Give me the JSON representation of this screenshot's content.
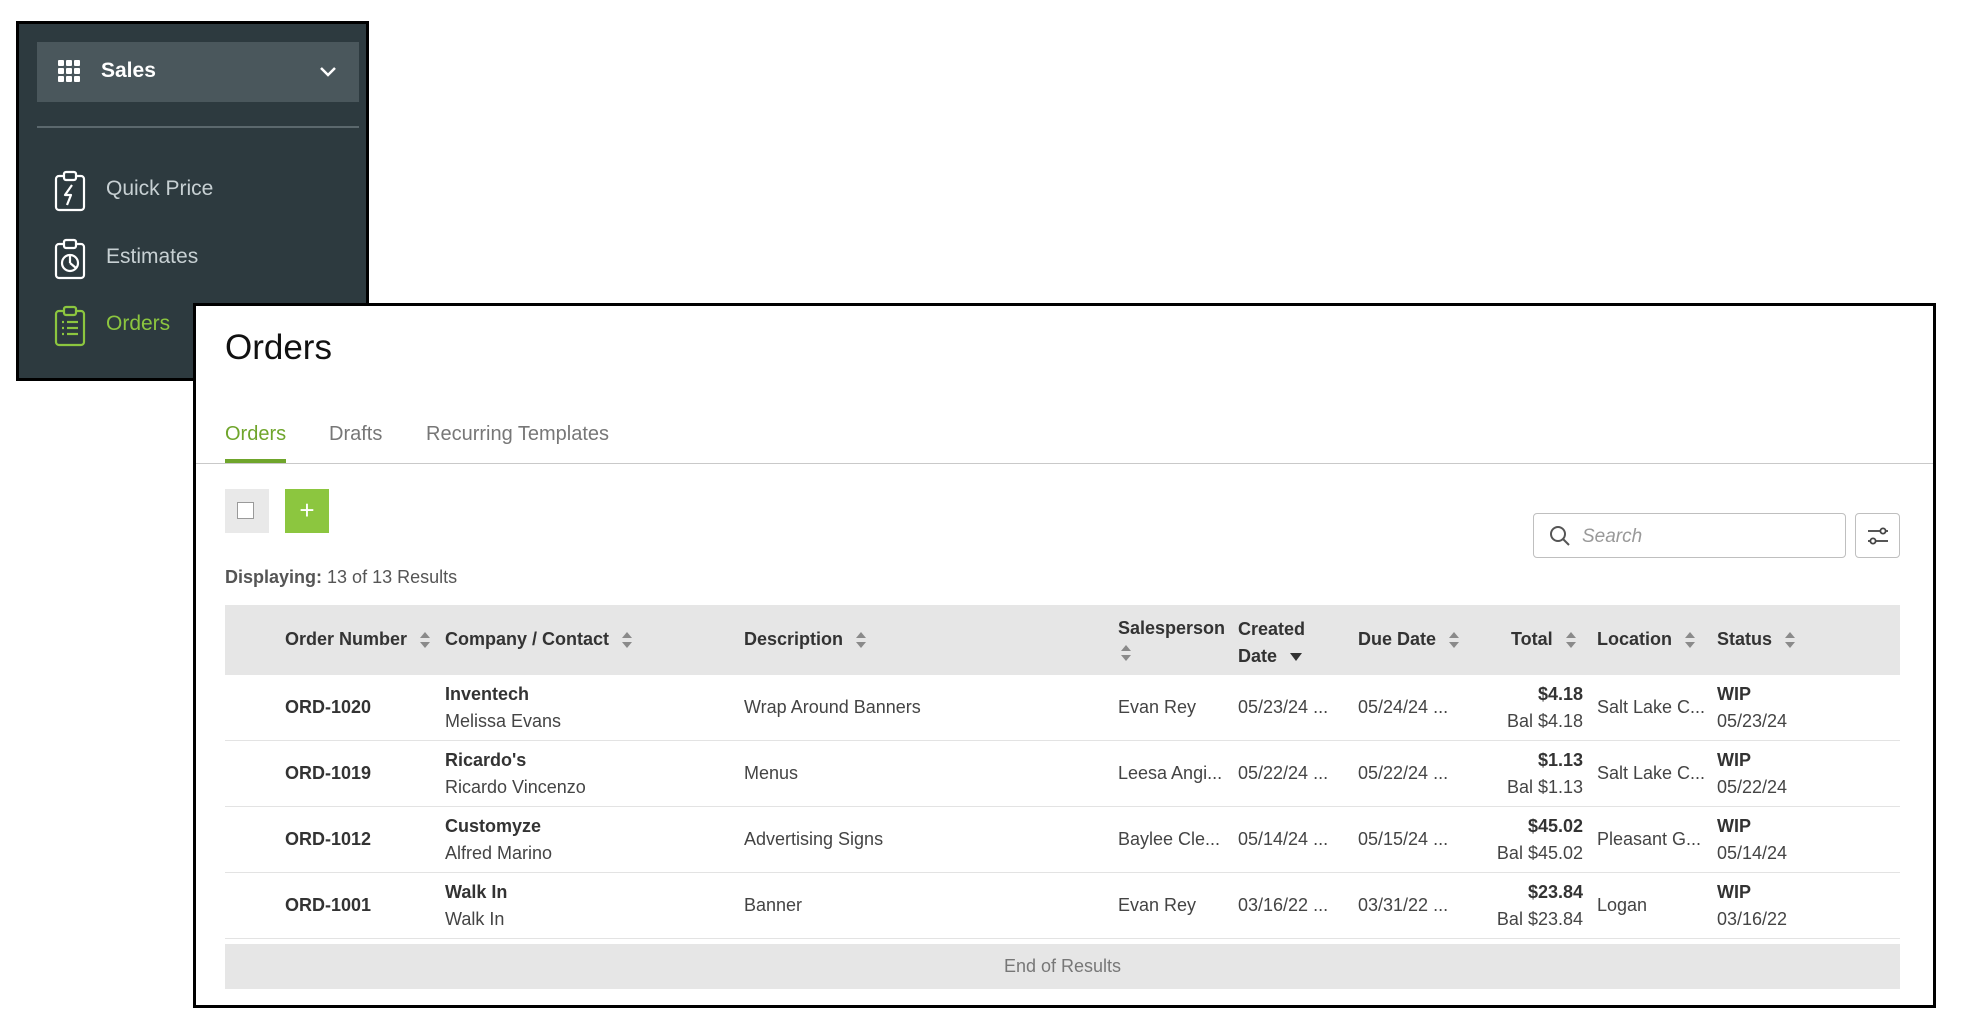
{
  "sidebar": {
    "module": "Sales",
    "items": [
      {
        "label": "Quick Price",
        "icon": "clipboard-lightning-icon"
      },
      {
        "label": "Estimates",
        "icon": "clipboard-chart-icon"
      },
      {
        "label": "Orders",
        "icon": "clipboard-list-icon",
        "active": true
      }
    ]
  },
  "page": {
    "title": "Orders",
    "tabs": [
      {
        "label": "Orders",
        "active": true
      },
      {
        "label": "Drafts"
      },
      {
        "label": "Recurring Templates"
      }
    ],
    "add_label": "+",
    "search_placeholder": "Search",
    "displaying_label": "Displaying:",
    "displaying_value": "13 of 13 Results",
    "end_of_results": "End of Results"
  },
  "table": {
    "columns": {
      "order_number": "Order Number",
      "company": "Company / Contact",
      "description": "Description",
      "salesperson": "Salesperson",
      "created_1": "Created",
      "created_2": "Date",
      "due": "Due Date",
      "total": "Total",
      "location": "Location",
      "status": "Status"
    },
    "rows": [
      {
        "order": "ORD-1020",
        "company": "Inventech",
        "contact": "Melissa Evans",
        "description": "Wrap Around Banners",
        "salesperson": "Evan Rey",
        "created": "05/23/24 ...",
        "due": "05/24/24 ...",
        "total": "$4.18",
        "balance": "Bal $4.18",
        "location": "Salt Lake C...",
        "status": "WIP",
        "status_date": "05/23/24"
      },
      {
        "order": "ORD-1019",
        "company": "Ricardo's",
        "contact": "Ricardo Vincenzo",
        "description": "Menus",
        "salesperson": "Leesa Angi...",
        "created": "05/22/24 ...",
        "due": "05/22/24 ...",
        "total": "$1.13",
        "balance": "Bal $1.13",
        "location": "Salt Lake C...",
        "status": "WIP",
        "status_date": "05/22/24"
      },
      {
        "order": "ORD-1012",
        "company": "Customyze",
        "contact": "Alfred Marino",
        "description": "Advertising Signs",
        "salesperson": "Baylee Cle...",
        "created": "05/14/24 ...",
        "due": "05/15/24 ...",
        "total": "$45.02",
        "balance": "Bal $45.02",
        "location": "Pleasant G...",
        "status": "WIP",
        "status_date": "05/14/24"
      },
      {
        "order": "ORD-1001",
        "company": "Walk In",
        "contact": "Walk In",
        "description": "Banner",
        "salesperson": "Evan Rey",
        "created": "03/16/22 ...",
        "due": "03/31/22 ...",
        "total": "$23.84",
        "balance": "Bal $23.84",
        "location": "Logan",
        "status": "WIP",
        "status_date": "03/16/22"
      }
    ]
  },
  "colors": {
    "sidebar_bg": "#2d3a3f",
    "accent": "#8cc63f",
    "active_tab": "#6fa52b",
    "header_bg": "#e6e6e6"
  }
}
